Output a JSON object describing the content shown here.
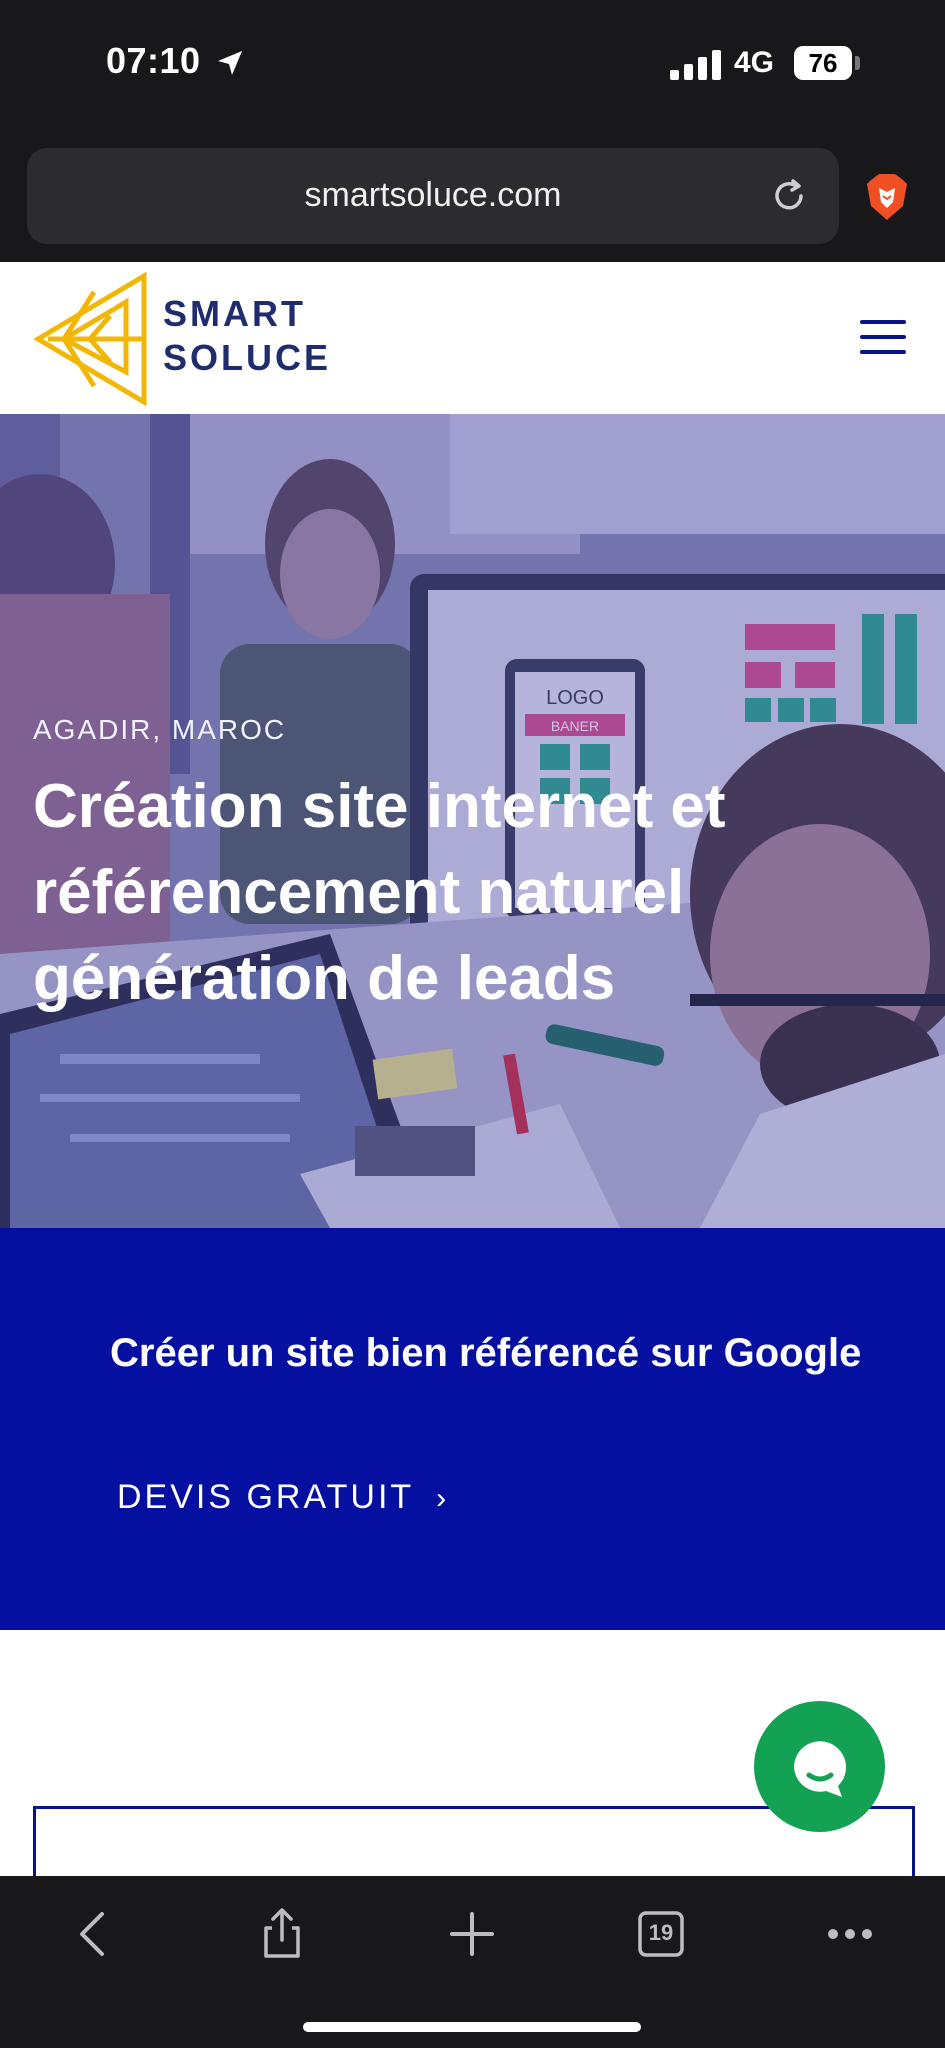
{
  "status_bar": {
    "time": "07:10",
    "network": "4G",
    "battery": "76"
  },
  "browser": {
    "url": "smartsoluce.com",
    "tab_count": "19"
  },
  "site": {
    "logo_line1": "SMART",
    "logo_line2": "SOLUCE",
    "brand_color": "#1f2c6e",
    "accent_color": "#f2b705"
  },
  "hero": {
    "kicker": "AGADIR, MAROC",
    "title": "Création site internet et référencement naturel génération de leads",
    "image_labels": [
      "LOGO",
      "BANER"
    ]
  },
  "cta": {
    "text": "Créer un site bien référencé sur Google",
    "button_label": "DEVIS GRATUIT",
    "band_color": "#0510a1"
  },
  "chat": {
    "color": "#13a154"
  },
  "icons": [
    "location-arrow-icon",
    "signal-icon",
    "reload-icon",
    "brave-lion-icon",
    "hamburger-menu-icon",
    "chevron-right-icon",
    "chat-bubble-icon",
    "back-icon",
    "share-icon",
    "plus-icon",
    "tabs-icon",
    "more-icon"
  ]
}
